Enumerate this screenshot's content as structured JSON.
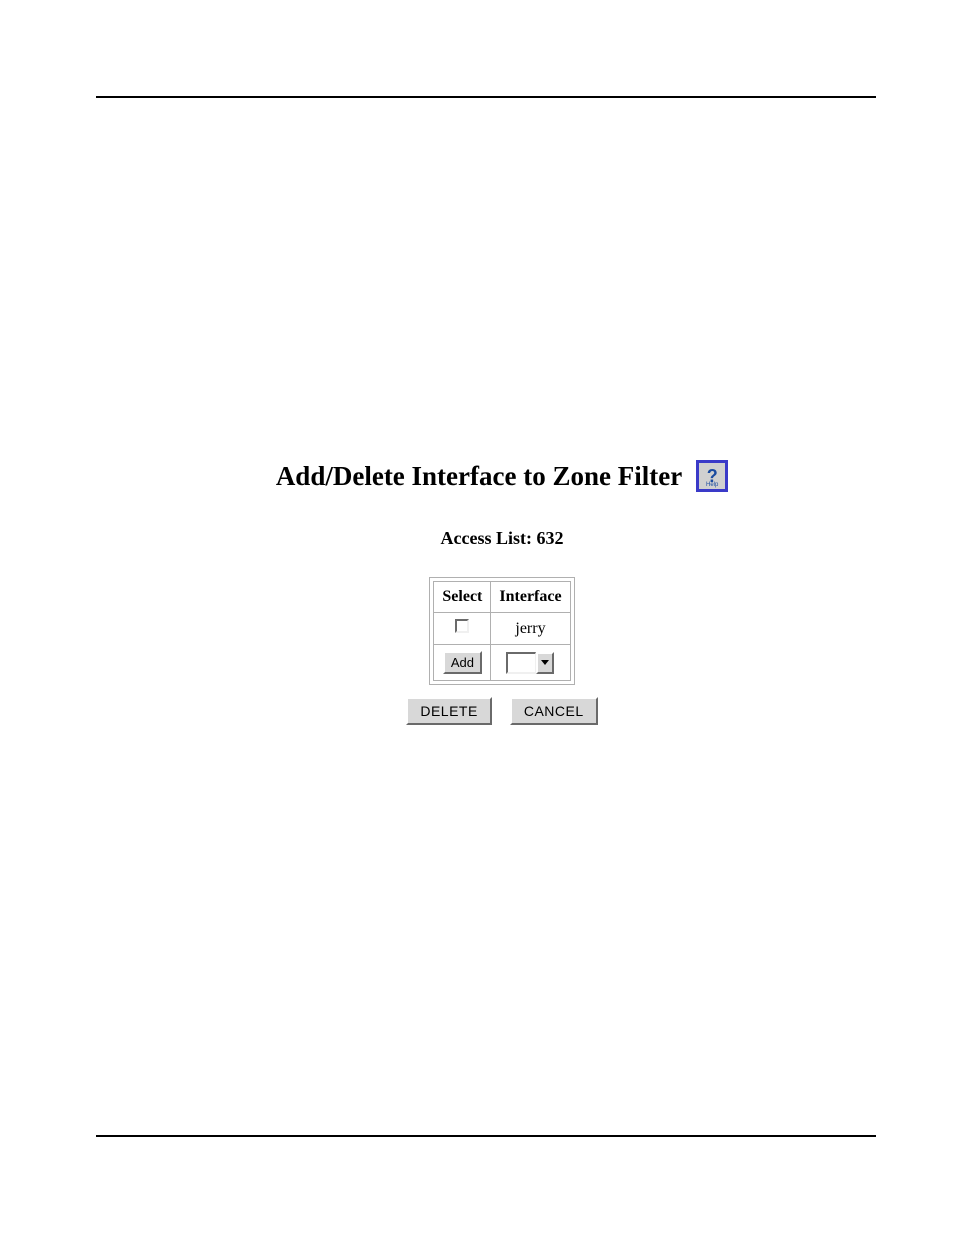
{
  "title": "Add/Delete Interface to Zone Filter",
  "help": {
    "label": "Help"
  },
  "access_list": {
    "label": "Access List:",
    "value": "632"
  },
  "table": {
    "headers": {
      "select": "Select",
      "interface": "Interface"
    },
    "rows": [
      {
        "interface": "jerry"
      }
    ],
    "add_button": "Add",
    "dropdown_selected": ""
  },
  "buttons": {
    "delete": "DELETE",
    "cancel": "CANCEL"
  }
}
